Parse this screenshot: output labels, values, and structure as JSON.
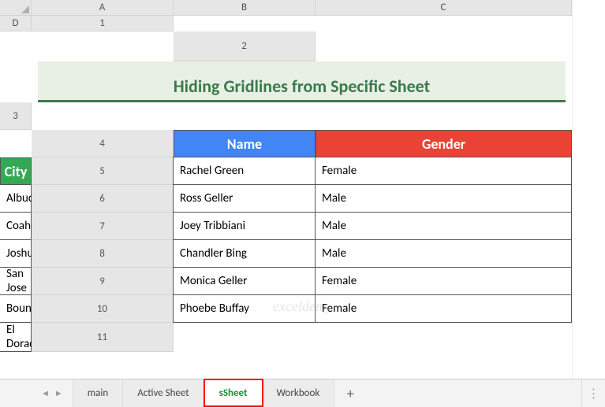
{
  "columns": [
    "A",
    "B",
    "C",
    "D"
  ],
  "rows": [
    "1",
    "2",
    "3",
    "4",
    "5",
    "6",
    "7",
    "8",
    "9",
    "10",
    "11"
  ],
  "title": "Hiding Gridlines from Specific Sheet",
  "headers": {
    "name": "Name",
    "gender": "Gender",
    "city": "City"
  },
  "data": [
    {
      "name": "Rachel Green",
      "gender": "Female",
      "city": "Albuquerque"
    },
    {
      "name": "Ross Geller",
      "gender": "Male",
      "city": "Coahoma"
    },
    {
      "name": "Joey Tribbiani",
      "gender": "Male",
      "city": "Joshua"
    },
    {
      "name": "Chandler Bing",
      "gender": "Male",
      "city": "San Jose"
    },
    {
      "name": "Monica Geller",
      "gender": "Female",
      "city": "Bountiful"
    },
    {
      "name": "Phoebe Buffay",
      "gender": "Female",
      "city": "El Dorado"
    }
  ],
  "tabs": [
    {
      "label": "main",
      "active": false,
      "highlighted": false
    },
    {
      "label": "Active Sheet",
      "active": false,
      "highlighted": false
    },
    {
      "label": "sSheet",
      "active": true,
      "highlighted": true
    },
    {
      "label": "Workbook",
      "active": false,
      "highlighted": false
    }
  ],
  "watermark": "exceldemy",
  "icons": {
    "add": "+",
    "menu": "⋮",
    "prev": "◄",
    "next": "►"
  }
}
